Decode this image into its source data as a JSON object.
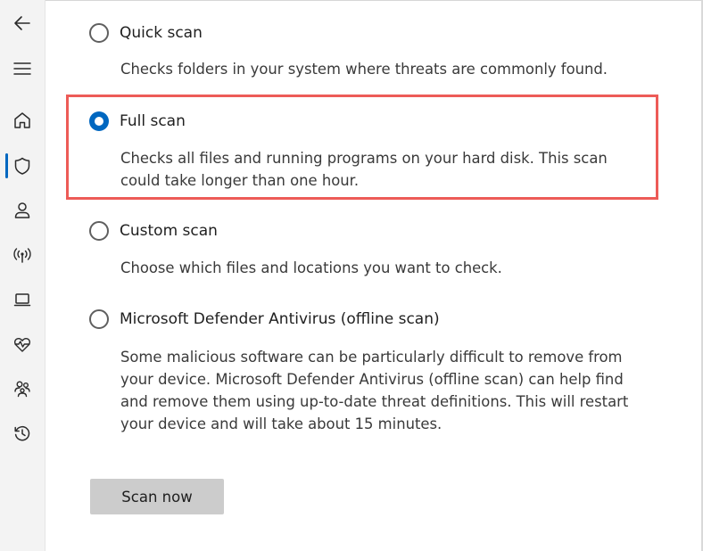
{
  "app": {
    "accent_color": "#0067c0",
    "highlight_color": "#ed5b57"
  },
  "sidebar": {
    "items": [
      {
        "name": "back",
        "icon": "back-arrow-icon"
      },
      {
        "name": "menu",
        "icon": "hamburger-menu-icon"
      },
      {
        "name": "home",
        "icon": "home-icon"
      },
      {
        "name": "virus-threat-protection",
        "icon": "shield-icon",
        "active": true
      },
      {
        "name": "account-protection",
        "icon": "person-icon"
      },
      {
        "name": "firewall-network-protection",
        "icon": "wireless-antenna-icon"
      },
      {
        "name": "app-browser-control",
        "icon": "laptop-icon"
      },
      {
        "name": "device-performance-health",
        "icon": "heart-pulse-icon"
      },
      {
        "name": "family-options",
        "icon": "family-icon"
      },
      {
        "name": "protection-history",
        "icon": "history-icon"
      }
    ]
  },
  "scan_options": {
    "quick": {
      "label": "Quick scan",
      "description": "Checks folders in your system where threats are commonly found.",
      "selected": false
    },
    "full": {
      "label": "Full scan",
      "description": "Checks all files and running programs on your hard disk. This scan could take longer than one hour.",
      "selected": true
    },
    "custom": {
      "label": "Custom scan",
      "description": "Choose which files and locations you want to check.",
      "selected": false
    },
    "offline": {
      "label": "Microsoft Defender Antivirus (offline scan)",
      "description": "Some malicious software can be particularly difficult to remove from your device. Microsoft Defender Antivirus (offline scan) can help find and remove them using up-to-date threat definitions. This will restart your device and will take about 15 minutes.",
      "selected": false
    }
  },
  "actions": {
    "scan_now_label": "Scan now"
  }
}
